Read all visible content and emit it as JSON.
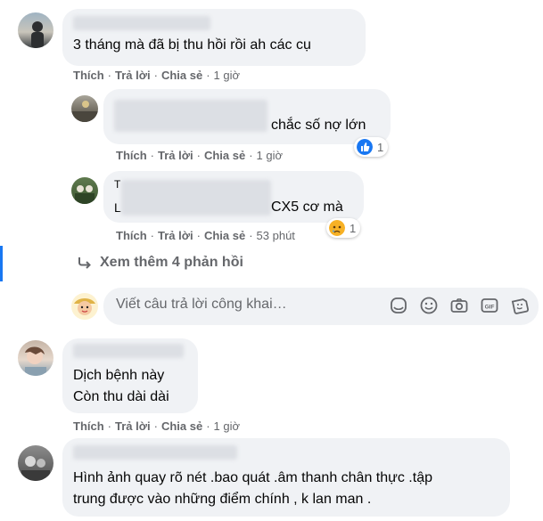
{
  "comments": [
    {
      "text": "3 tháng mà đã bị thu hồi rồi ah các cụ",
      "actions": {
        "like": "Thích",
        "reply": "Trả lời",
        "share": "Chia sẻ",
        "time": "1 giờ"
      }
    },
    {
      "text": "chắc số nợ lớn",
      "actions": {
        "like": "Thích",
        "reply": "Trả lời",
        "share": "Chia sẻ",
        "time": "1 giờ"
      },
      "reaction": {
        "type": "like",
        "count": "1"
      }
    },
    {
      "prefix1": "T",
      "prefix2": "L",
      "text": "CX5 cơ mà",
      "actions": {
        "like": "Thích",
        "reply": "Trả lời",
        "share": "Chia sẻ",
        "time": "53 phút"
      },
      "reaction": {
        "type": "sad",
        "count": "1"
      }
    },
    {
      "line1": "Dịch bệnh này",
      "line2": "Còn thu dài dài",
      "actions": {
        "like": "Thích",
        "reply": "Trả lời",
        "share": "Chia sẻ",
        "time": "1 giờ"
      }
    },
    {
      "line1": "Hình ảnh quay rõ nét .bao quát .âm thanh chân thực .tập",
      "line2": "trung được vào những điểm chính , k lan man ."
    }
  ],
  "more_replies": "Xem thêm 4 phản hồi",
  "reply_input": {
    "placeholder": "Viết câu trả lời công khai…"
  },
  "tool_icons": [
    "sticker-icon",
    "emoji-icon",
    "camera-icon",
    "gif-icon",
    "avatar-sticker-icon"
  ],
  "colors": {
    "link_blue": "#1877f2",
    "bubble": "#f0f2f5",
    "meta_gray": "#65676b"
  },
  "separator": "·"
}
